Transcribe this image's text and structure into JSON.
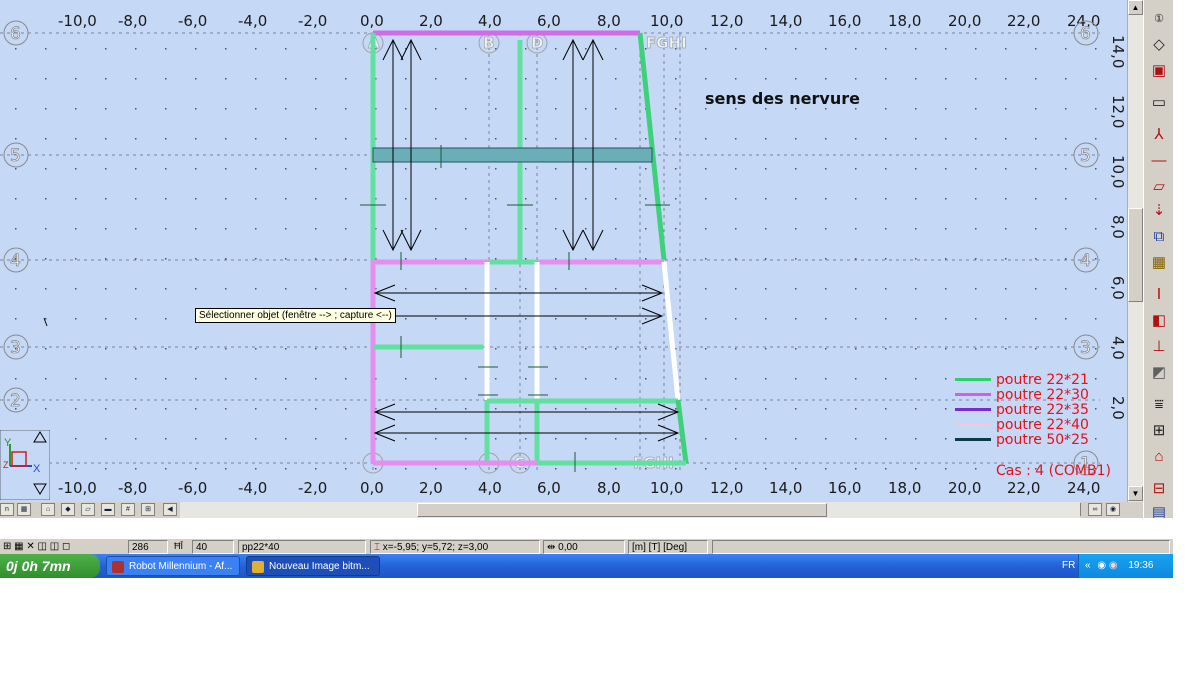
{
  "top_axis": {
    "ticks": [
      "-10,0",
      "-8,0",
      "-6,0",
      "-4,0",
      "-2,0",
      "0,0",
      "2,0",
      "4,0",
      "6,0",
      "8,0",
      "10,0",
      "12,0",
      "14,0",
      "16,0",
      "18,0",
      "20,0",
      "22,0",
      "24,0"
    ]
  },
  "bottom_axis": {
    "ticks": [
      "-10,0",
      "-8,0",
      "-6,0",
      "-4,0",
      "-2,0",
      "0,0",
      "2,0",
      "4,0",
      "6,0",
      "8,0",
      "10,0",
      "12,0",
      "14,0",
      "16,0",
      "18,0",
      "20,0",
      "22,0",
      "24,0"
    ]
  },
  "vertical_axis": {
    "ticks": [
      "14,0",
      "12,0",
      "10,0",
      "8,0",
      "6,0",
      "4,0",
      "2,0"
    ]
  },
  "grid_rows": [
    "6",
    "5",
    "4",
    "3",
    "2",
    "1"
  ],
  "grid_cols": [
    "A",
    "B",
    "C",
    "D",
    "FGHI"
  ],
  "annotation": "sens des nervure",
  "tooltip": "Sélectionner objet (fenêtre --> ; capture <--)",
  "legend": [
    {
      "label": "poutre 22*21",
      "color": "#2fd06a"
    },
    {
      "label": "poutre 22*30",
      "color": "#d060e8"
    },
    {
      "label": "poutre 22*35",
      "color": "#7a2ad0"
    },
    {
      "label": "poutre 22*40",
      "color": "#f4c8d8"
    },
    {
      "label": "poutre 50*25",
      "color": "#0a3a4a"
    }
  ],
  "case_label": "Cas : 4 (COMB1)",
  "axes_widget": {
    "y": "Y",
    "x": "X",
    "z": "Z"
  },
  "status": {
    "node_count": "286",
    "icon_label": "40",
    "section": "pp22*40",
    "coords": "x=-5,95; y=5,72; z=3,00",
    "offset": "0,00",
    "units": "[m] [T] [Deg]"
  },
  "taskbar": {
    "timer": "0j 0h 7mn",
    "tasks": [
      "Robot Millennium - Af...",
      "Nouveau Image bitm..."
    ],
    "lang": "FR",
    "clock": "19:36"
  }
}
